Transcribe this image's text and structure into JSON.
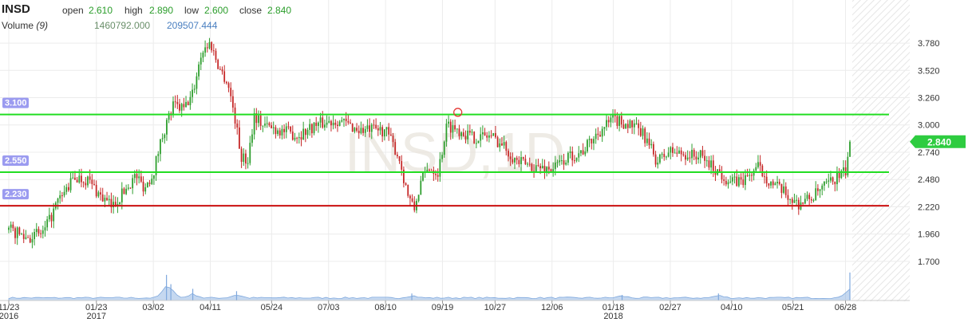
{
  "header": {
    "symbol": "INSD",
    "open_label": "open",
    "open_value": "2.610",
    "high_label": "high",
    "high_value": "2.890",
    "low_label": "low",
    "low_value": "2.600",
    "close_label": "close",
    "close_value": "2.840",
    "volume_label": "Volume",
    "volume_period": "(9)",
    "volume_value_1": "1460792.000",
    "volume_value_2": "209507.444"
  },
  "watermark": "INSD,1D",
  "colors": {
    "up": "#2e9e2e",
    "down": "#c62828",
    "support_line": "#22dd22",
    "resistance_line": "#cc1111",
    "price_tag": "#2ecc40",
    "level_tag": "#9b9bf0",
    "volume": "#7fa8dd",
    "grid": "#ececec"
  },
  "chart_data": {
    "type": "candlestick",
    "symbol": "INSD",
    "interval": "1D",
    "y_ticks": [
      "3.780",
      "3.520",
      "3.260",
      "3.000",
      "2.740",
      "2.480",
      "2.220",
      "1.960",
      "1.700"
    ],
    "y_range": [
      1.57,
      3.94
    ],
    "x_ticks": [
      {
        "label": "11/23",
        "sub": "2016",
        "month": 0
      },
      {
        "label": "01/23",
        "sub": "2017",
        "month": 2
      },
      {
        "label": "03/02",
        "sub": "",
        "month": 3.3
      },
      {
        "label": "04/11",
        "sub": "",
        "month": 4.6
      },
      {
        "label": "05/24",
        "sub": "",
        "month": 6
      },
      {
        "label": "07/03",
        "sub": "",
        "month": 7.3
      },
      {
        "label": "08/10",
        "sub": "",
        "month": 8.6
      },
      {
        "label": "09/19",
        "sub": "",
        "month": 9.9
      },
      {
        "label": "10/27",
        "sub": "",
        "month": 11.1
      },
      {
        "label": "12/06",
        "sub": "",
        "month": 12.4
      },
      {
        "label": "01/18",
        "sub": "2018",
        "month": 13.8
      },
      {
        "label": "02/27",
        "sub": "",
        "month": 15.1
      },
      {
        "label": "04/10",
        "sub": "",
        "month": 16.5
      },
      {
        "label": "05/21",
        "sub": "",
        "month": 17.9
      },
      {
        "label": "06/28",
        "sub": "",
        "month": 19.1
      }
    ],
    "horizontal_lines": [
      {
        "value": 3.1,
        "label": "3.100",
        "color": "#22dd22"
      },
      {
        "value": 2.55,
        "label": "2.550",
        "color": "#22dd22"
      },
      {
        "value": 2.23,
        "label": "2.230",
        "color": "#cc1111"
      }
    ],
    "last_price": {
      "value": 2.84,
      "label": "2.840"
    },
    "marker": {
      "month": 10.25,
      "value": 3.12
    },
    "price_path": [
      [
        0,
        2.0
      ],
      [
        0.4,
        1.93
      ],
      [
        0.8,
        1.97
      ],
      [
        1.1,
        2.25
      ],
      [
        1.5,
        2.5
      ],
      [
        1.8,
        2.48
      ],
      [
        2.1,
        2.32
      ],
      [
        2.35,
        2.22
      ],
      [
        2.6,
        2.35
      ],
      [
        2.9,
        2.52
      ],
      [
        3.1,
        2.4
      ],
      [
        3.3,
        2.55
      ],
      [
        3.5,
        2.9
      ],
      [
        3.75,
        3.18
      ],
      [
        4.0,
        3.15
      ],
      [
        4.2,
        3.3
      ],
      [
        4.4,
        3.7
      ],
      [
        4.6,
        3.78
      ],
      [
        4.8,
        3.55
      ],
      [
        5.0,
        3.4
      ],
      [
        5.15,
        3.1
      ],
      [
        5.3,
        2.7
      ],
      [
        5.45,
        2.65
      ],
      [
        5.6,
        3.1
      ],
      [
        5.8,
        3.0
      ],
      [
        6.2,
        2.95
      ],
      [
        6.6,
        2.9
      ],
      [
        7.0,
        3.0
      ],
      [
        7.5,
        3.05
      ],
      [
        8.0,
        2.95
      ],
      [
        8.6,
        2.95
      ],
      [
        8.9,
        2.7
      ],
      [
        9.1,
        2.35
      ],
      [
        9.25,
        2.18
      ],
      [
        9.4,
        2.45
      ],
      [
        9.6,
        2.6
      ],
      [
        9.8,
        2.55
      ],
      [
        10.0,
        3.0
      ],
      [
        10.3,
        2.95
      ],
      [
        10.6,
        2.88
      ],
      [
        11.0,
        2.9
      ],
      [
        11.3,
        2.8
      ],
      [
        11.6,
        2.65
      ],
      [
        12.0,
        2.6
      ],
      [
        12.4,
        2.58
      ],
      [
        12.8,
        2.7
      ],
      [
        13.1,
        2.75
      ],
      [
        13.5,
        2.95
      ],
      [
        13.8,
        3.05
      ],
      [
        14.2,
        3.0
      ],
      [
        14.5,
        2.9
      ],
      [
        14.8,
        2.65
      ],
      [
        15.1,
        2.75
      ],
      [
        15.4,
        2.72
      ],
      [
        15.8,
        2.7
      ],
      [
        16.2,
        2.55
      ],
      [
        16.5,
        2.45
      ],
      [
        16.8,
        2.48
      ],
      [
        17.1,
        2.6
      ],
      [
        17.4,
        2.45
      ],
      [
        17.7,
        2.35
      ],
      [
        18.0,
        2.25
      ],
      [
        18.3,
        2.3
      ],
      [
        18.6,
        2.4
      ],
      [
        18.9,
        2.5
      ],
      [
        19.1,
        2.55
      ],
      [
        19.2,
        2.84
      ]
    ],
    "volume_bumps": [
      {
        "month": 3.6,
        "height": 0.55
      },
      {
        "month": 3.7,
        "height": 0.35
      },
      {
        "month": 4.2,
        "height": 0.25
      },
      {
        "month": 5.2,
        "height": 0.2
      },
      {
        "month": 9.2,
        "height": 0.15
      },
      {
        "month": 14.0,
        "height": 0.12
      },
      {
        "month": 16.2,
        "height": 0.15
      },
      {
        "month": 19.2,
        "height": 0.6
      }
    ]
  }
}
